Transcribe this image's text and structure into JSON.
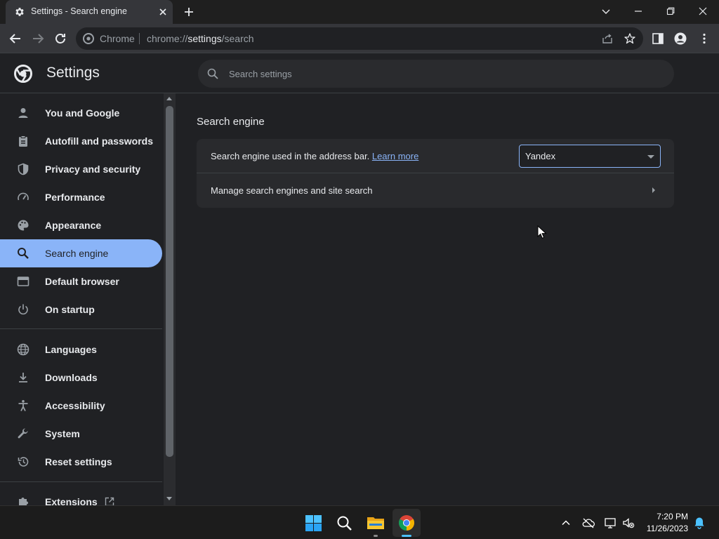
{
  "browser": {
    "tab_title": "Settings - Search engine",
    "address_chip": "Chrome",
    "url_scheme": "chrome://",
    "url_host": "settings",
    "url_path": "/search"
  },
  "settings": {
    "title": "Settings",
    "search_placeholder": "Search settings"
  },
  "sidebar": {
    "items": [
      {
        "label": "You and Google",
        "icon": "person-icon"
      },
      {
        "label": "Autofill and passwords",
        "icon": "clipboard-icon"
      },
      {
        "label": "Privacy and security",
        "icon": "shield-icon"
      },
      {
        "label": "Performance",
        "icon": "speedometer-icon"
      },
      {
        "label": "Appearance",
        "icon": "palette-icon"
      },
      {
        "label": "Search engine",
        "icon": "search-icon",
        "active": true
      },
      {
        "label": "Default browser",
        "icon": "browser-window-icon"
      },
      {
        "label": "On startup",
        "icon": "power-icon"
      },
      {
        "label": "Languages",
        "icon": "globe-icon"
      },
      {
        "label": "Downloads",
        "icon": "download-icon"
      },
      {
        "label": "Accessibility",
        "icon": "accessibility-icon"
      },
      {
        "label": "System",
        "icon": "wrench-icon"
      },
      {
        "label": "Reset settings",
        "icon": "history-icon"
      },
      {
        "label": "Extensions",
        "icon": "puzzle-icon"
      }
    ]
  },
  "main": {
    "section_title": "Search engine",
    "row1_text": "Search engine used in the address bar.",
    "learn_more": "Learn more",
    "selected_engine": "Yandex",
    "row2_text": "Manage search engines and site search"
  },
  "taskbar": {
    "time": "7:20 PM",
    "date": "11/26/2023"
  },
  "colors": {
    "accent": "#8ab4f8",
    "background": "#202124",
    "card": "#292a2d"
  }
}
